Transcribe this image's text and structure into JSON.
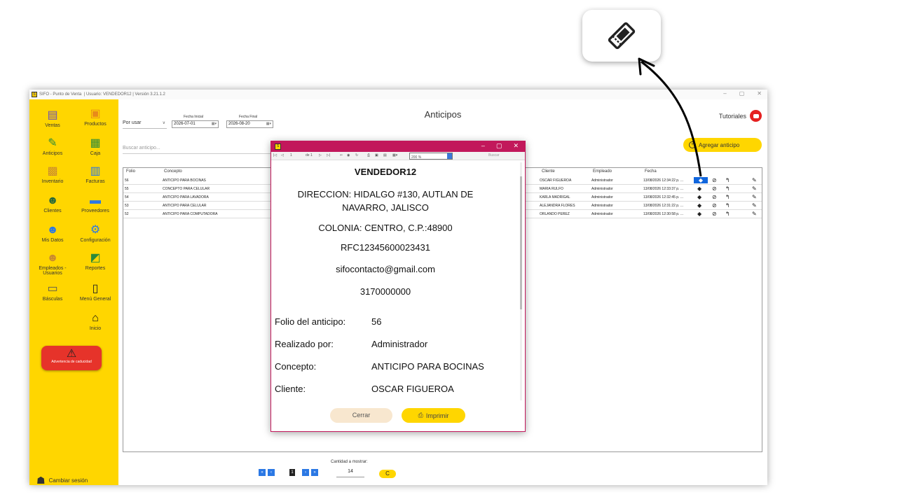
{
  "app": {
    "title_name": "SIFO - Punto de Venta",
    "title_user": "| Usuario: VENDEDOR12 | Versión 3.21.1.2",
    "window_controls": [
      "–",
      "▢",
      "✕"
    ]
  },
  "sidebar": {
    "items": [
      {
        "label": "Ventas",
        "icon": "cash-register-icon"
      },
      {
        "label": "Productos",
        "icon": "box-icon"
      },
      {
        "label": "Anticipos",
        "icon": "tag-icon"
      },
      {
        "label": "Caja",
        "icon": "money-icon"
      },
      {
        "label": "Inventario",
        "icon": "boxes-icon"
      },
      {
        "label": "Facturas",
        "icon": "invoice-icon"
      },
      {
        "label": "Clientes",
        "icon": "client-icon"
      },
      {
        "label": "Proveedores",
        "icon": "truck-icon"
      },
      {
        "label": "Mis Datos",
        "icon": "user-icon"
      },
      {
        "label": "Configuración",
        "icon": "gear-icon"
      },
      {
        "label": "Empleados - Usuarios",
        "icon": "users-icon"
      },
      {
        "label": "Reportes",
        "icon": "chart-icon"
      },
      {
        "label": "Básculas",
        "icon": "scale-icon"
      },
      {
        "label": "Menú General",
        "icon": "clipboard-icon"
      },
      {
        "label": "Inicio",
        "icon": "home-icon"
      }
    ],
    "warning_label": "Advertencia de caducidad",
    "logout_label": "Cambiar sesión"
  },
  "main": {
    "title": "Anticipos",
    "tutorials_label": "Tutoriales",
    "filter_value": "Por usar",
    "start_date_label": "Fecha Inicial",
    "start_date_value": "2026-07-01",
    "end_date_label": "Fecha Final",
    "end_date_value": "2026-08-20",
    "search_placeholder": "Buscar anticipo...",
    "add_button_label": "Agregar anticipo",
    "columns": [
      "Folio",
      "Concepto",
      "Cliente",
      "Empleado",
      "Fecha"
    ],
    "rows": [
      {
        "folio": "56",
        "concepto": "ANTICIPO PARA BOCINAS",
        "cliente": "OSCAR FIGUEROA",
        "empleado": "Administrador",
        "fecha": "13/08/2026 12:34:22 p. ..."
      },
      {
        "folio": "55",
        "concepto": "CONCEPTO PARA CELULAR",
        "cliente": "MARIA RULFO",
        "empleado": "Administrador",
        "fecha": "13/08/2026 12:33:37 p. ..."
      },
      {
        "folio": "54",
        "concepto": "ANTICIPO PARA LAVADORA",
        "cliente": "KARLA MADRIGAL",
        "empleado": "Administrador",
        "fecha": "13/08/2026 12:32:45 p. ..."
      },
      {
        "folio": "53",
        "concepto": "ANTICIPO PARA CELULAR",
        "cliente": "ALEJANDRA FLORES",
        "empleado": "Administrador",
        "fecha": "13/08/2026 12:31:22 p. ..."
      },
      {
        "folio": "52",
        "concepto": "ANTICIPO PARA COMPUTADORA",
        "cliente": "ORLANDO PEREZ",
        "empleado": "Administrador",
        "fecha": "13/08/2026 12:30:58 p. ..."
      }
    ],
    "row_action_icons": [
      "ticket-icon",
      "cancel-icon",
      "undo-icon",
      "edit-icon"
    ],
    "quantity_label": "Cantidad a mostrar:",
    "quantity_value": "14",
    "page_number": "1",
    "refresh_glyph": "C"
  },
  "modal": {
    "report_page": "1",
    "report_of": "de 1",
    "zoom_value": "200 %",
    "find_label": "Buscar",
    "header": "VENDEDOR12",
    "address": "DIRECCION: HIDALGO #130, AUTLAN DE NAVARRO, JALISCO",
    "colony": "COLONIA: CENTRO, C.P.:48900",
    "rfc": "RFC12345600023431",
    "email": "sifocontacto@gmail.com",
    "phone": "3170000000",
    "fields": [
      {
        "label": "Folio del anticipo:",
        "value": "56"
      },
      {
        "label": "Realizado por:",
        "value": "Administrador"
      },
      {
        "label": "Concepto:",
        "value": "ANTICIPO PARA BOCINAS"
      },
      {
        "label": "Cliente:",
        "value": "OSCAR FIGUEROA"
      }
    ],
    "close_label": "Cerrar",
    "print_label": "Imprimir"
  },
  "callout": {
    "icon": "ticket-icon"
  },
  "colors": {
    "accent": "#ffd600",
    "modal_bar": "#c2185b",
    "selection": "#1166dd",
    "danger": "#e6332a"
  }
}
